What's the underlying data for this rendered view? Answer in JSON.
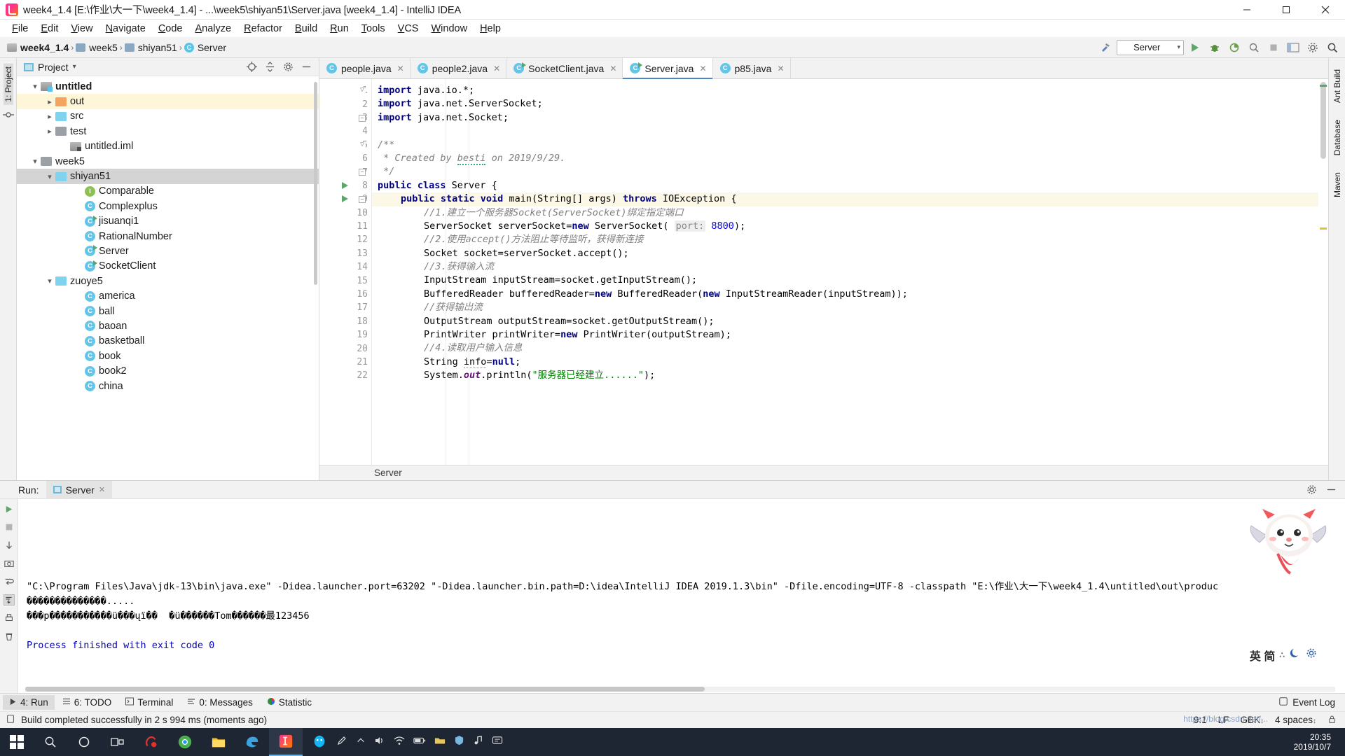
{
  "titlebar": {
    "title": "week4_1.4 [E:\\作业\\大一下\\week4_1.4] - ...\\week5\\shiyan51\\Server.java [week4_1.4] - IntelliJ IDEA",
    "minimize": "—",
    "maximize": "☐",
    "close": "✕"
  },
  "menubar": {
    "items": [
      "File",
      "Edit",
      "View",
      "Navigate",
      "Code",
      "Analyze",
      "Refactor",
      "Build",
      "Run",
      "Tools",
      "VCS",
      "Window",
      "Help"
    ]
  },
  "navbar": {
    "crumbs": [
      "week4_1.4",
      "week5",
      "shiyan51",
      "Server"
    ],
    "separator": "›",
    "run_config": "Server",
    "run_config_caret": "▾"
  },
  "rails": {
    "left_top": "1: Project",
    "left_items": [
      "structure-icon",
      "favorites-icon"
    ],
    "right_items": [
      "Ant Build",
      "Database",
      "Maven"
    ]
  },
  "project_panel": {
    "title": "Project",
    "title_caret": "▾",
    "tree": [
      {
        "label": "untitled",
        "depth": 1,
        "arrow": "open",
        "icon": "modbadge",
        "bold": true
      },
      {
        "label": "out",
        "depth": 2,
        "arrow": "closed",
        "icon": "orange",
        "state": "hl"
      },
      {
        "label": "src",
        "depth": 2,
        "arrow": "closed",
        "icon": "blue"
      },
      {
        "label": "test",
        "depth": 2,
        "arrow": "closed",
        "icon": "gray"
      },
      {
        "label": "untitled.iml",
        "depth": 3,
        "arrow": "none",
        "icon": "mod"
      },
      {
        "label": "week5",
        "depth": 1,
        "arrow": "open",
        "icon": "gray"
      },
      {
        "label": "shiyan51",
        "depth": 2,
        "arrow": "open",
        "icon": "blue",
        "state": "sel"
      },
      {
        "label": "Comparable",
        "depth": 4,
        "arrow": "none",
        "icon": "interface"
      },
      {
        "label": "Complexplus",
        "depth": 4,
        "arrow": "none",
        "icon": "class"
      },
      {
        "label": "jisuanqi1",
        "depth": 4,
        "arrow": "none",
        "icon": "class-run"
      },
      {
        "label": "RationalNumber",
        "depth": 4,
        "arrow": "none",
        "icon": "class"
      },
      {
        "label": "Server",
        "depth": 4,
        "arrow": "none",
        "icon": "class-run"
      },
      {
        "label": "SocketClient",
        "depth": 4,
        "arrow": "none",
        "icon": "class-run"
      },
      {
        "label": "zuoye5",
        "depth": 2,
        "arrow": "open",
        "icon": "blue"
      },
      {
        "label": "america",
        "depth": 4,
        "arrow": "none",
        "icon": "class"
      },
      {
        "label": "ball",
        "depth": 4,
        "arrow": "none",
        "icon": "class"
      },
      {
        "label": "baoan",
        "depth": 4,
        "arrow": "none",
        "icon": "class"
      },
      {
        "label": "basketball",
        "depth": 4,
        "arrow": "none",
        "icon": "class"
      },
      {
        "label": "book",
        "depth": 4,
        "arrow": "none",
        "icon": "class"
      },
      {
        "label": "book2",
        "depth": 4,
        "arrow": "none",
        "icon": "class"
      },
      {
        "label": "china",
        "depth": 4,
        "arrow": "none",
        "icon": "class"
      }
    ]
  },
  "editor": {
    "tabs": [
      {
        "label": "people.java",
        "icon": "class",
        "active": false
      },
      {
        "label": "people2.java",
        "icon": "class",
        "active": false
      },
      {
        "label": "SocketClient.java",
        "icon": "class-run",
        "active": false
      },
      {
        "label": "Server.java",
        "icon": "class-run",
        "active": true
      },
      {
        "label": "p85.java",
        "icon": "class",
        "active": false
      }
    ],
    "tab_close": "✕",
    "breadcrumb": "Server",
    "lines": [
      {
        "n": 1,
        "indent": 1,
        "fold": "tri",
        "tokens": [
          {
            "t": "import ",
            "c": "kw"
          },
          {
            "t": "java.io.*;",
            "c": ""
          }
        ]
      },
      {
        "n": 2,
        "indent": 1,
        "tokens": [
          {
            "t": "import ",
            "c": "kw"
          },
          {
            "t": "java.net.ServerSocket;",
            "c": ""
          }
        ]
      },
      {
        "n": 3,
        "indent": 1,
        "fold": "minus",
        "tokens": [
          {
            "t": "import ",
            "c": "kw"
          },
          {
            "t": "java.net.Socket;",
            "c": ""
          }
        ]
      },
      {
        "n": 4,
        "indent": 1,
        "tokens": []
      },
      {
        "n": 5,
        "indent": 1,
        "fold": "tri",
        "tokens": [
          {
            "t": "/**",
            "c": "cm"
          }
        ]
      },
      {
        "n": 6,
        "indent": 1,
        "tokens": [
          {
            "t": " * Created by ",
            "c": "cm"
          },
          {
            "t": "besti",
            "c": "cm squiggle"
          },
          {
            "t": " on 2019/9/29.",
            "c": "cm"
          }
        ]
      },
      {
        "n": 7,
        "indent": 1,
        "fold": "minus",
        "tokens": [
          {
            "t": " */",
            "c": "cm"
          }
        ]
      },
      {
        "n": 8,
        "indent": 1,
        "run": true,
        "tokens": [
          {
            "t": "public class ",
            "c": "kw"
          },
          {
            "t": "Server {",
            "c": ""
          }
        ]
      },
      {
        "n": 9,
        "indent": 2,
        "run": true,
        "fold": "minus",
        "highlight": true,
        "tokens": [
          {
            "t": "public static void ",
            "c": "kw"
          },
          {
            "t": "main(String[] args) ",
            "c": ""
          },
          {
            "t": "throws ",
            "c": "kw"
          },
          {
            "t": "IOException {",
            "c": ""
          }
        ]
      },
      {
        "n": 10,
        "indent": 3,
        "tokens": [
          {
            "t": "//1.建立一个服务器Socket(ServerSocket)绑定指定端口",
            "c": "cm"
          }
        ]
      },
      {
        "n": 11,
        "indent": 3,
        "tokens": [
          {
            "t": "ServerSocket serverSocket=",
            "c": ""
          },
          {
            "t": "new",
            "c": "kw"
          },
          {
            "t": " ServerSocket( ",
            "c": ""
          },
          {
            "t": "port:",
            "c": "hint"
          },
          {
            "t": " ",
            "c": ""
          },
          {
            "t": "8800",
            "c": "num2"
          },
          {
            "t": ");",
            "c": ""
          }
        ]
      },
      {
        "n": 12,
        "indent": 3,
        "tokens": [
          {
            "t": "//2.使用accept()方法阻止等待监听，获得新连接",
            "c": "cm"
          }
        ]
      },
      {
        "n": 13,
        "indent": 3,
        "tokens": [
          {
            "t": "Socket socket=serverSocket.accept();",
            "c": ""
          }
        ]
      },
      {
        "n": 14,
        "indent": 3,
        "tokens": [
          {
            "t": "//3.获得输入流",
            "c": "cm"
          }
        ]
      },
      {
        "n": 15,
        "indent": 3,
        "tokens": [
          {
            "t": "InputStream inputStream=socket.getInputStream();",
            "c": ""
          }
        ]
      },
      {
        "n": 16,
        "indent": 3,
        "tokens": [
          {
            "t": "BufferedReader bufferedReader=",
            "c": ""
          },
          {
            "t": "new",
            "c": "kw"
          },
          {
            "t": " BufferedReader(",
            "c": ""
          },
          {
            "t": "new",
            "c": "kw"
          },
          {
            "t": " InputStreamReader(inputStream));",
            "c": ""
          }
        ]
      },
      {
        "n": 17,
        "indent": 3,
        "tokens": [
          {
            "t": "//获得输出流",
            "c": "cm"
          }
        ]
      },
      {
        "n": 18,
        "indent": 3,
        "tokens": [
          {
            "t": "OutputStream outputStream=socket.getOutputStream();",
            "c": ""
          }
        ]
      },
      {
        "n": 19,
        "indent": 3,
        "tokens": [
          {
            "t": "PrintWriter printWriter=",
            "c": ""
          },
          {
            "t": "new",
            "c": "kw"
          },
          {
            "t": " PrintWriter(outputStream);",
            "c": ""
          }
        ]
      },
      {
        "n": 20,
        "indent": 3,
        "tokens": [
          {
            "t": "//4.读取用户输入信息",
            "c": "cm"
          }
        ]
      },
      {
        "n": 21,
        "indent": 3,
        "tokens": [
          {
            "t": "String ",
            "c": ""
          },
          {
            "t": "info",
            "c": "und"
          },
          {
            "t": "=",
            "c": ""
          },
          {
            "t": "null",
            "c": "kw"
          },
          {
            "t": ";",
            "c": ""
          }
        ]
      },
      {
        "n": 22,
        "indent": 3,
        "tokens": [
          {
            "t": "System.",
            "c": ""
          },
          {
            "t": "out",
            "c": "fld"
          },
          {
            "t": ".println(",
            "c": ""
          },
          {
            "t": "\"服务器已经建立......\"",
            "c": "str"
          },
          {
            "t": ");",
            "c": ""
          }
        ]
      }
    ]
  },
  "run_panel": {
    "label": "Run:",
    "tab": "Server",
    "tab_close": "✕",
    "console": [
      {
        "text": "\"C:\\Program Files\\Java\\jdk-13\\bin\\java.exe\" -Didea.launcher.port=63202 \"-Didea.launcher.bin.path=D:\\idea\\IntelliJ IDEA 2019.1.3\\bin\" -Dfile.encoding=UTF-8 -classpath \"E:\\作业\\大一下\\week4_1.4\\untitled\\out\\produc",
        "class": ""
      },
      {
        "text": "��������������.....",
        "class": ""
      },
      {
        "text": "���p�����������ü���ųï��  �ü������Tom������最123456",
        "class": ""
      },
      {
        "text": "",
        "class": ""
      },
      {
        "text": "Process finished with exit code 0",
        "class": "blue"
      }
    ]
  },
  "bottom_toolwindows": {
    "items": [
      {
        "label": "4: Run",
        "icon": "play-icon",
        "active": true
      },
      {
        "label": "6: TODO",
        "icon": "list-icon",
        "active": false
      },
      {
        "label": "Terminal",
        "icon": "terminal-icon",
        "active": false
      },
      {
        "label": "0: Messages",
        "icon": "messages-icon",
        "active": false
      },
      {
        "label": "Statistic",
        "icon": "statistic-icon",
        "active": false
      }
    ],
    "event_log": "Event Log"
  },
  "statusbar": {
    "message": "Build completed successfully in 2 s 994 ms (moments ago)",
    "caret": "9:1",
    "line_separator": "LF",
    "encoding": "GBK",
    "encoding_caret": "↕",
    "indent": "4 spaces",
    "indent_caret": "↕"
  },
  "taskbar": {
    "clock_time": "20:35",
    "clock_date": "2019/10/7",
    "ime": "英 简",
    "watermark": "https://blog.csdn.net/..."
  },
  "colors": {
    "accent": "#4a86c8",
    "keyword": "#000080",
    "comment": "#808080",
    "string": "#008000",
    "number": "#0000ff",
    "run_green": "#59a869",
    "selection": "#d4d4d4",
    "highlight_line": "#fcf8e8"
  }
}
